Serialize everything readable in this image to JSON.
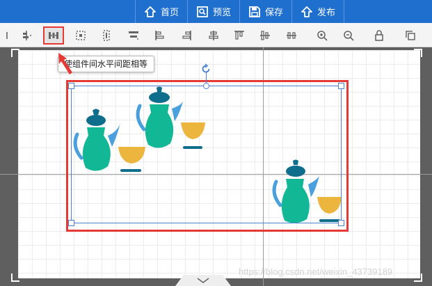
{
  "header": {
    "nav": [
      {
        "label": "首页",
        "icon": "home-icon"
      },
      {
        "label": "预览",
        "icon": "preview-icon"
      },
      {
        "label": "保存",
        "icon": "save-icon"
      },
      {
        "label": "发布",
        "icon": "publish-icon"
      }
    ],
    "bar_color": "#1f6fcf"
  },
  "toolbar": {
    "tools": [
      {
        "name": "align-top-spacing-icon"
      },
      {
        "name": "distribute-horizontal-spacing-icon",
        "active": true
      },
      {
        "name": "group-icon"
      },
      {
        "name": "ungroup-icon"
      },
      {
        "name": "align-top-icon"
      },
      {
        "name": "align-left-icon"
      },
      {
        "name": "align-right-icon"
      },
      {
        "name": "align-center-vertical-icon"
      },
      {
        "name": "align-top-edge-icon"
      },
      {
        "name": "align-middle-icon"
      },
      {
        "name": "zoom-in-icon"
      },
      {
        "name": "zoom-out-icon"
      },
      {
        "name": "lock-icon"
      },
      {
        "name": "copy-icon"
      }
    ]
  },
  "tooltip": {
    "text": "使组件间水平间距相等"
  },
  "colors": {
    "pot_teal": "#12b896",
    "pot_lid": "#0f6e8c",
    "pot_handle": "#4aa0dc",
    "cup_yellow": "#ecb63e",
    "selection_red": "#e53935",
    "selection_blue": "#4a7fd4"
  },
  "watermark": "https://blog.csdn.net/weixin_43739189"
}
